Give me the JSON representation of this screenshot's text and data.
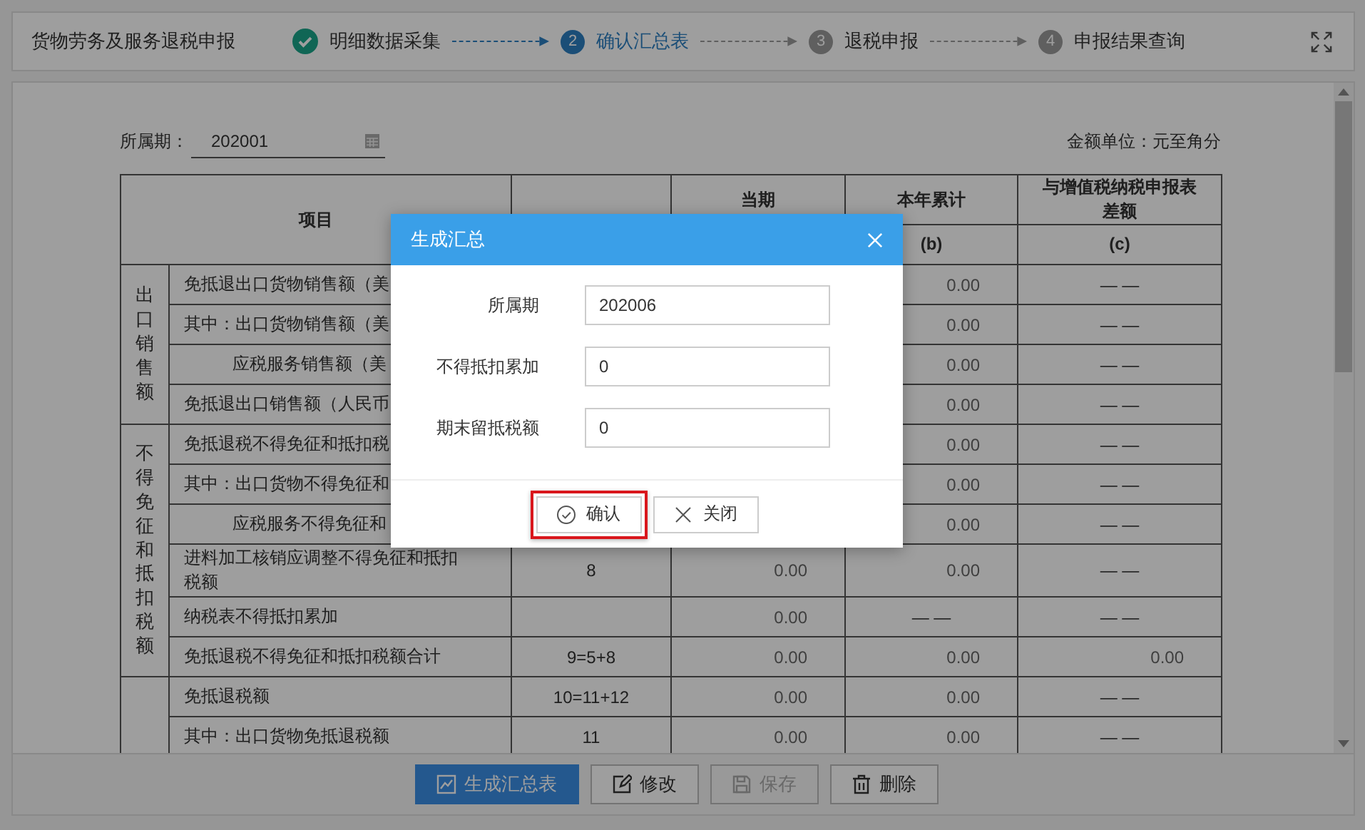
{
  "header": {
    "title": "货物劳务及服务退税申报",
    "steps": [
      {
        "done": true,
        "selected": false,
        "label": "明细数据采集"
      },
      {
        "done": false,
        "selected": true,
        "number": "2",
        "label": "确认汇总表"
      },
      {
        "done": false,
        "selected": false,
        "number": "3",
        "label": "退税申报"
      },
      {
        "done": false,
        "selected": false,
        "number": "4",
        "label": "申报结果查询"
      }
    ]
  },
  "form": {
    "period_label": "所属期：",
    "period_value": "202001",
    "unit": "金额单位：元至角分"
  },
  "table": {
    "item_header": "项目",
    "headers": [
      {
        "top": "当期"
      },
      {
        "top": "本年累计",
        "bottom": "(b)"
      },
      {
        "top": "与增值税纳税申报表差额",
        "bottom": "(c)"
      }
    ],
    "groups": [
      {
        "label": "出口销售额",
        "rows": [
          {
            "item": "免抵退出口货物销售额（美",
            "indent": false,
            "ytd": {
              "text": "0.00",
              "kind": "amount"
            },
            "diff": {
              "text": "— —",
              "kind": "na"
            }
          },
          {
            "item": "其中：出口货物销售额（美",
            "indent": false,
            "ytd": {
              "text": "0.00",
              "kind": "amount"
            },
            "diff": {
              "text": "— —",
              "kind": "na"
            }
          },
          {
            "item": "应税服务销售额（美",
            "indent": true,
            "ytd": {
              "text": "0.00",
              "kind": "amount"
            },
            "diff": {
              "text": "— —",
              "kind": "na"
            }
          },
          {
            "item": "免抵退出口销售额（人民币",
            "indent": false,
            "ytd": {
              "text": "0.00",
              "kind": "amount"
            },
            "diff": {
              "text": "— —",
              "kind": "na"
            }
          }
        ]
      },
      {
        "label": "不得免征和抵扣税额",
        "rows": [
          {
            "item": "免抵退税不得免征和抵扣税",
            "indent": false,
            "ytd": {
              "text": "0.00",
              "kind": "amount"
            },
            "diff": {
              "text": "— —",
              "kind": "na"
            }
          },
          {
            "item": "其中：出口货物不得免征和",
            "indent": false,
            "ytd": {
              "text": "0.00",
              "kind": "amount"
            },
            "diff": {
              "text": "— —",
              "kind": "na"
            }
          },
          {
            "item": "应税服务不得免征和",
            "indent": true,
            "ytd": {
              "text": "0.00",
              "kind": "amount"
            },
            "diff": {
              "text": "— —",
              "kind": "na"
            }
          },
          {
            "item": "进料加工核销应调整不得免征和抵扣税额",
            "indent": false,
            "line": "8",
            "current": {
              "text": "0.00",
              "kind": "amount"
            },
            "ytd": {
              "text": "0.00",
              "kind": "amount"
            },
            "diff": {
              "text": "— —",
              "kind": "na"
            }
          },
          {
            "item": "纳税表不得抵扣累加",
            "indent": false,
            "current": {
              "text": "0.00",
              "kind": "amount"
            },
            "ytd": {
              "text": "— —",
              "kind": "na"
            },
            "diff": {
              "text": "— —",
              "kind": "na"
            }
          },
          {
            "item": "免抵退税不得免征和抵扣税额合计",
            "indent": false,
            "line": "9=5+8",
            "current": {
              "text": "0.00",
              "kind": "amount"
            },
            "ytd": {
              "text": "0.00",
              "kind": "amount"
            },
            "diff": {
              "text": "0.00",
              "kind": "amount"
            }
          }
        ]
      },
      {
        "rows": [
          {
            "item": "免抵退税额",
            "indent": false,
            "line": "10=11+12",
            "current": {
              "text": "0.00",
              "kind": "amount"
            },
            "ytd": {
              "text": "0.00",
              "kind": "amount"
            },
            "diff": {
              "text": "— —",
              "kind": "na"
            }
          },
          {
            "item": "其中：出口货物免抵退税额",
            "indent": false,
            "line": "11",
            "current": {
              "text": "0.00",
              "kind": "amount"
            },
            "ytd": {
              "text": "0.00",
              "kind": "amount"
            },
            "diff": {
              "text": "— —",
              "kind": "na"
            }
          }
        ]
      }
    ]
  },
  "toolbar": [
    {
      "label": "生成汇总表",
      "kind": "generate",
      "primary": true,
      "disabled": false
    },
    {
      "label": "修改",
      "kind": "edit",
      "primary": false,
      "disabled": false
    },
    {
      "label": "保存",
      "kind": "save",
      "primary": false,
      "disabled": true
    },
    {
      "label": "删除",
      "kind": "delete",
      "primary": false,
      "disabled": false
    }
  ],
  "modal": {
    "title": "生成汇总",
    "fields": [
      {
        "label": "所属期",
        "value": "202006"
      },
      {
        "label": "不得抵扣累加",
        "value": "0"
      },
      {
        "label": "期末留抵税额",
        "value": "0"
      }
    ],
    "buttons": [
      {
        "label": "确认",
        "kind": "confirm",
        "highlighted": true
      },
      {
        "label": "关闭",
        "kind": "close",
        "highlighted": false
      }
    ]
  }
}
